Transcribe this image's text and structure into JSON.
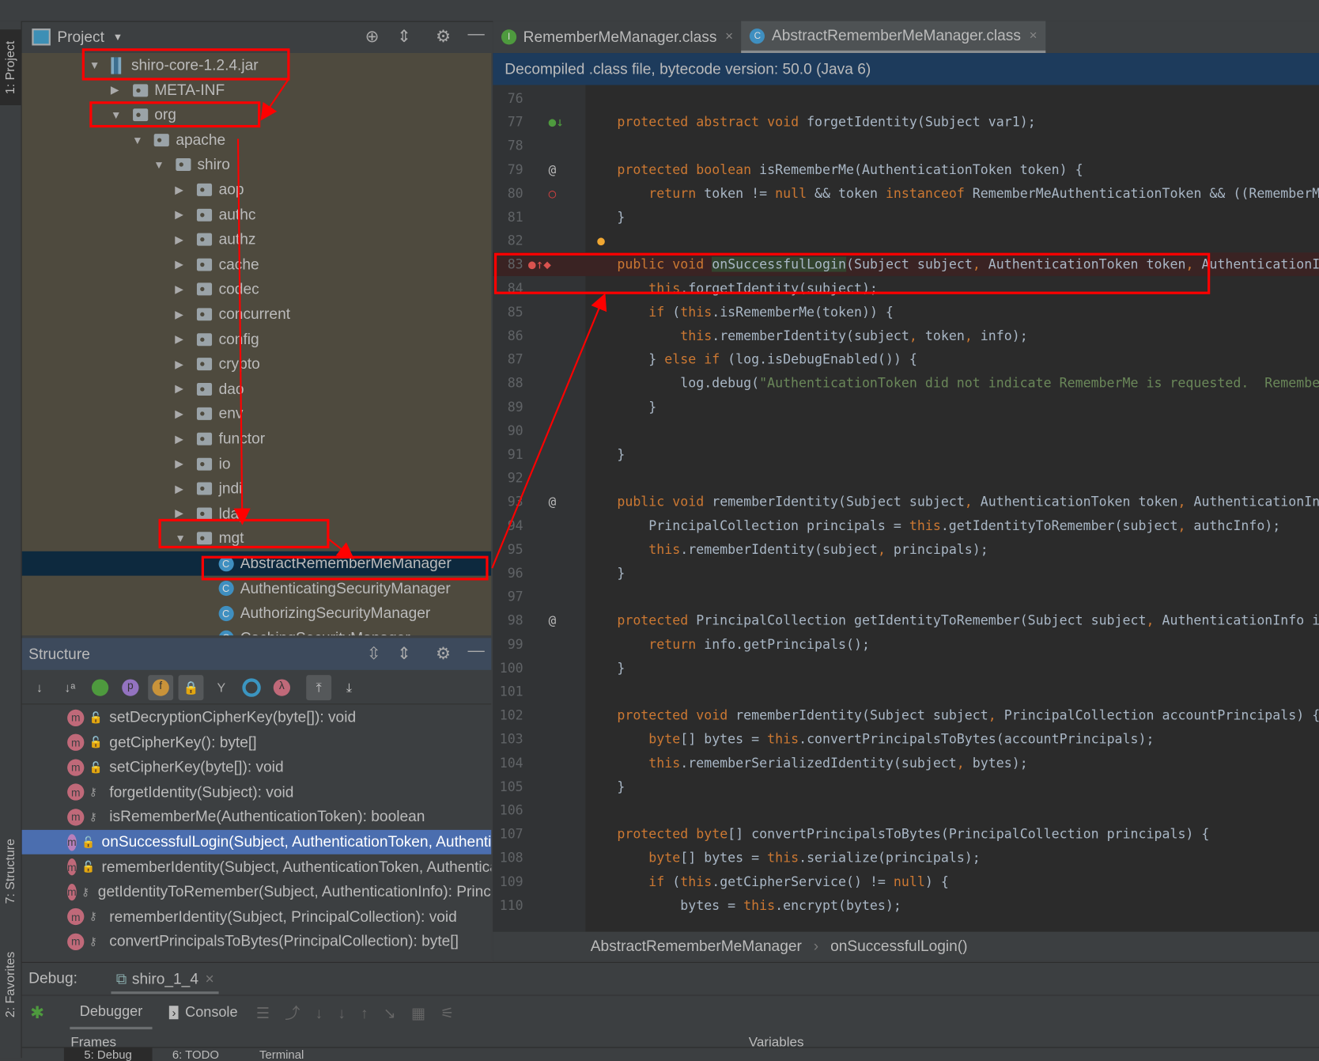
{
  "side_tabs": {
    "project": "1: Project",
    "structure": "7: Structure",
    "favorites": "2: Favorites"
  },
  "project": {
    "title": "Project",
    "items": [
      {
        "label": "shiro-core-1.2.4.jar",
        "level": 0,
        "kind": "jar",
        "open": true
      },
      {
        "label": "META-INF",
        "level": 1,
        "kind": "folder",
        "open": false
      },
      {
        "label": "org",
        "level": 1,
        "kind": "folder",
        "open": true
      },
      {
        "label": "apache",
        "level": 2,
        "kind": "folder",
        "open": true
      },
      {
        "label": "shiro",
        "level": 3,
        "kind": "folder",
        "open": true
      },
      {
        "label": "aop",
        "level": 4,
        "kind": "folder",
        "open": false
      },
      {
        "label": "authc",
        "level": 4,
        "kind": "folder",
        "open": false
      },
      {
        "label": "authz",
        "level": 4,
        "kind": "folder",
        "open": false
      },
      {
        "label": "cache",
        "level": 4,
        "kind": "folder",
        "open": false
      },
      {
        "label": "codec",
        "level": 4,
        "kind": "folder",
        "open": false
      },
      {
        "label": "concurrent",
        "level": 4,
        "kind": "folder",
        "open": false
      },
      {
        "label": "config",
        "level": 4,
        "kind": "folder",
        "open": false
      },
      {
        "label": "crypto",
        "level": 4,
        "kind": "folder",
        "open": false
      },
      {
        "label": "dao",
        "level": 4,
        "kind": "folder",
        "open": false
      },
      {
        "label": "env",
        "level": 4,
        "kind": "folder",
        "open": false
      },
      {
        "label": "functor",
        "level": 4,
        "kind": "folder",
        "open": false
      },
      {
        "label": "io",
        "level": 4,
        "kind": "folder",
        "open": false
      },
      {
        "label": "jndi",
        "level": 4,
        "kind": "folder",
        "open": false
      },
      {
        "label": "ldap",
        "level": 4,
        "kind": "folder",
        "open": false
      },
      {
        "label": "mgt",
        "level": 4,
        "kind": "folder",
        "open": true
      },
      {
        "label": "AbstractRememberMeManager",
        "level": 5,
        "kind": "class",
        "selected": true
      },
      {
        "label": "AuthenticatingSecurityManager",
        "level": 5,
        "kind": "class"
      },
      {
        "label": "AuthorizingSecurityManager",
        "level": 5,
        "kind": "class"
      },
      {
        "label": "CachingSecurityManager",
        "level": 5,
        "kind": "class"
      }
    ]
  },
  "structure": {
    "title": "Structure",
    "items": [
      {
        "label": "setDecryptionCipherKey(byte[]): void",
        "access": "public"
      },
      {
        "label": "getCipherKey(): byte[]",
        "access": "public"
      },
      {
        "label": "setCipherKey(byte[]): void",
        "access": "public"
      },
      {
        "label": "forgetIdentity(Subject): void",
        "access": "protected",
        "abstract": true
      },
      {
        "label": "isRememberMe(AuthenticationToken): boolean",
        "access": "protected"
      },
      {
        "label": "onSuccessfulLogin(Subject, AuthenticationToken, AuthenticationInfo): void",
        "access": "public",
        "selected": true
      },
      {
        "label": "rememberIdentity(Subject, AuthenticationToken, AuthenticationInfo): void",
        "access": "public"
      },
      {
        "label": "getIdentityToRemember(Subject, AuthenticationInfo): PrincipalCollection",
        "access": "protected"
      },
      {
        "label": "rememberIdentity(Subject, PrincipalCollection): void",
        "access": "protected"
      },
      {
        "label": "convertPrincipalsToBytes(PrincipalCollection): byte[]",
        "access": "protected"
      }
    ]
  },
  "editor": {
    "tabs": [
      {
        "label": "RememberMeManager.class",
        "icon": "interface-icon",
        "active": false
      },
      {
        "label": "AbstractRememberMeManager.class",
        "icon": "abstract-class-icon",
        "active": true
      }
    ],
    "banner": "Decompiled .class file, bytecode version: 50.0 (Java 6)",
    "highlight_word": "onSuccessfulLogin",
    "lines": [
      {
        "n": "76",
        "t": ""
      },
      {
        "n": "77",
        "t": "    protected abstract void forgetIdentity(Subject var1);",
        "g": "impl"
      },
      {
        "n": "78",
        "t": ""
      },
      {
        "n": "79",
        "t": "    protected boolean isRememberMe(AuthenticationToken token) {",
        "g": "at"
      },
      {
        "n": "80",
        "t": "        return token != null && token instanceof RememberMeAuthenticationToken && ((RememberM",
        "g": "bp"
      },
      {
        "n": "81",
        "t": "    }"
      },
      {
        "n": "82",
        "t": ""
      },
      {
        "n": "83",
        "t": "    public void onSuccessfulLogin(Subject subject, AuthenticationToken token, AuthenticationI",
        "g": "cur"
      },
      {
        "n": "84",
        "t": "        this.forgetIdentity(subject);"
      },
      {
        "n": "85",
        "t": "        if (this.isRememberMe(token)) {"
      },
      {
        "n": "86",
        "t": "            this.rememberIdentity(subject, token, info);"
      },
      {
        "n": "87",
        "t": "        } else if (log.isDebugEnabled()) {"
      },
      {
        "n": "88",
        "t": "            log.debug(\"AuthenticationToken did not indicate RememberMe is requested.  Remembe"
      },
      {
        "n": "89",
        "t": "        }"
      },
      {
        "n": "90",
        "t": ""
      },
      {
        "n": "91",
        "t": "    }"
      },
      {
        "n": "92",
        "t": ""
      },
      {
        "n": "93",
        "t": "    public void rememberIdentity(Subject subject, AuthenticationToken token, AuthenticationIn",
        "g": "at"
      },
      {
        "n": "94",
        "t": "        PrincipalCollection principals = this.getIdentityToRemember(subject, authcInfo);"
      },
      {
        "n": "95",
        "t": "        this.rememberIdentity(subject, principals);"
      },
      {
        "n": "96",
        "t": "    }"
      },
      {
        "n": "97",
        "t": ""
      },
      {
        "n": "98",
        "t": "    protected PrincipalCollection getIdentityToRemember(Subject subject, AuthenticationInfo i",
        "g": "at"
      },
      {
        "n": "99",
        "t": "        return info.getPrincipals();"
      },
      {
        "n": "100",
        "t": "    }"
      },
      {
        "n": "101",
        "t": ""
      },
      {
        "n": "102",
        "t": "    protected void rememberIdentity(Subject subject, PrincipalCollection accountPrincipals) {"
      },
      {
        "n": "103",
        "t": "        byte[] bytes = this.convertPrincipalsToBytes(accountPrincipals);"
      },
      {
        "n": "104",
        "t": "        this.rememberSerializedIdentity(subject, bytes);"
      },
      {
        "n": "105",
        "t": "    }"
      },
      {
        "n": "106",
        "t": ""
      },
      {
        "n": "107",
        "t": "    protected byte[] convertPrincipalsToBytes(PrincipalCollection principals) {"
      },
      {
        "n": "108",
        "t": "        byte[] bytes = this.serialize(principals);"
      },
      {
        "n": "109",
        "t": "        if (this.getCipherService() != null) {"
      },
      {
        "n": "110",
        "t": "            bytes = this.encrypt(bytes);"
      }
    ],
    "breadcrumb": [
      "AbstractRememberMeManager",
      "onSuccessfulLogin()"
    ]
  },
  "debug": {
    "label": "Debug:",
    "session": "shiro_1_4",
    "tabs": [
      "Debugger",
      "Console"
    ],
    "frames": "Frames",
    "variables": "Variables"
  },
  "bottom_tabs": [
    "5: Debug",
    "6: TODO",
    "Terminal"
  ],
  "colors": {
    "keyword": "#cc7832",
    "string": "#6a8759",
    "text": "#a9b7c6",
    "selection": "#4b6eaf",
    "annotation": "#ff0000",
    "library_bg": "#4e4a3e"
  }
}
